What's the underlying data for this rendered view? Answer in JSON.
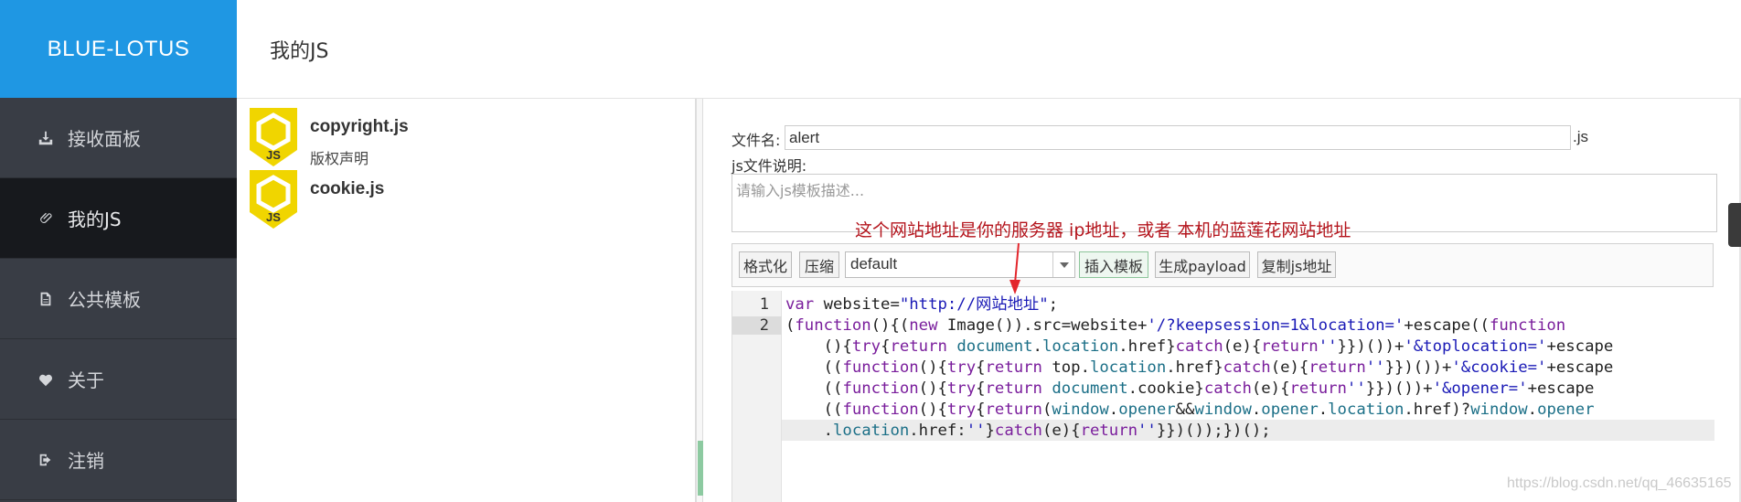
{
  "brand": "BLUE-LOTUS",
  "header_title": "我的JS",
  "nav": [
    {
      "label": "接收面板",
      "icon": "download-tray-icon"
    },
    {
      "label": "我的JS",
      "icon": "paperclip-icon"
    },
    {
      "label": "公共模板",
      "icon": "document-icon"
    },
    {
      "label": "关于",
      "icon": "heart-icon"
    },
    {
      "label": "注销",
      "icon": "logout-icon"
    }
  ],
  "files": [
    {
      "name": "copyright.js",
      "desc": "版权声明"
    },
    {
      "name": "cookie.js",
      "desc": ""
    }
  ],
  "editor": {
    "filename_label": "文件名:",
    "filename_value": "alert",
    "ext": ".js",
    "desc_label": "js文件说明:",
    "desc_placeholder": "请输入js模板描述...",
    "annotation": "这个网站地址是你的服务器 ip地址，或者 本机的蓝莲花网站地址",
    "toolbar": {
      "format": "格式化",
      "compress": "压缩",
      "template_select": "default",
      "insert_template": "插入模板",
      "gen_payload": "生成payload",
      "copy_url": "复制js地址"
    },
    "line_numbers": [
      "1",
      "2"
    ]
  },
  "watermark": "https://blog.csdn.net/qq_46635165",
  "colors": {
    "brand": "#1f97e3",
    "sidebar": "#393d45",
    "sidebar_active": "#17191d",
    "annotation": "#b4141c"
  }
}
